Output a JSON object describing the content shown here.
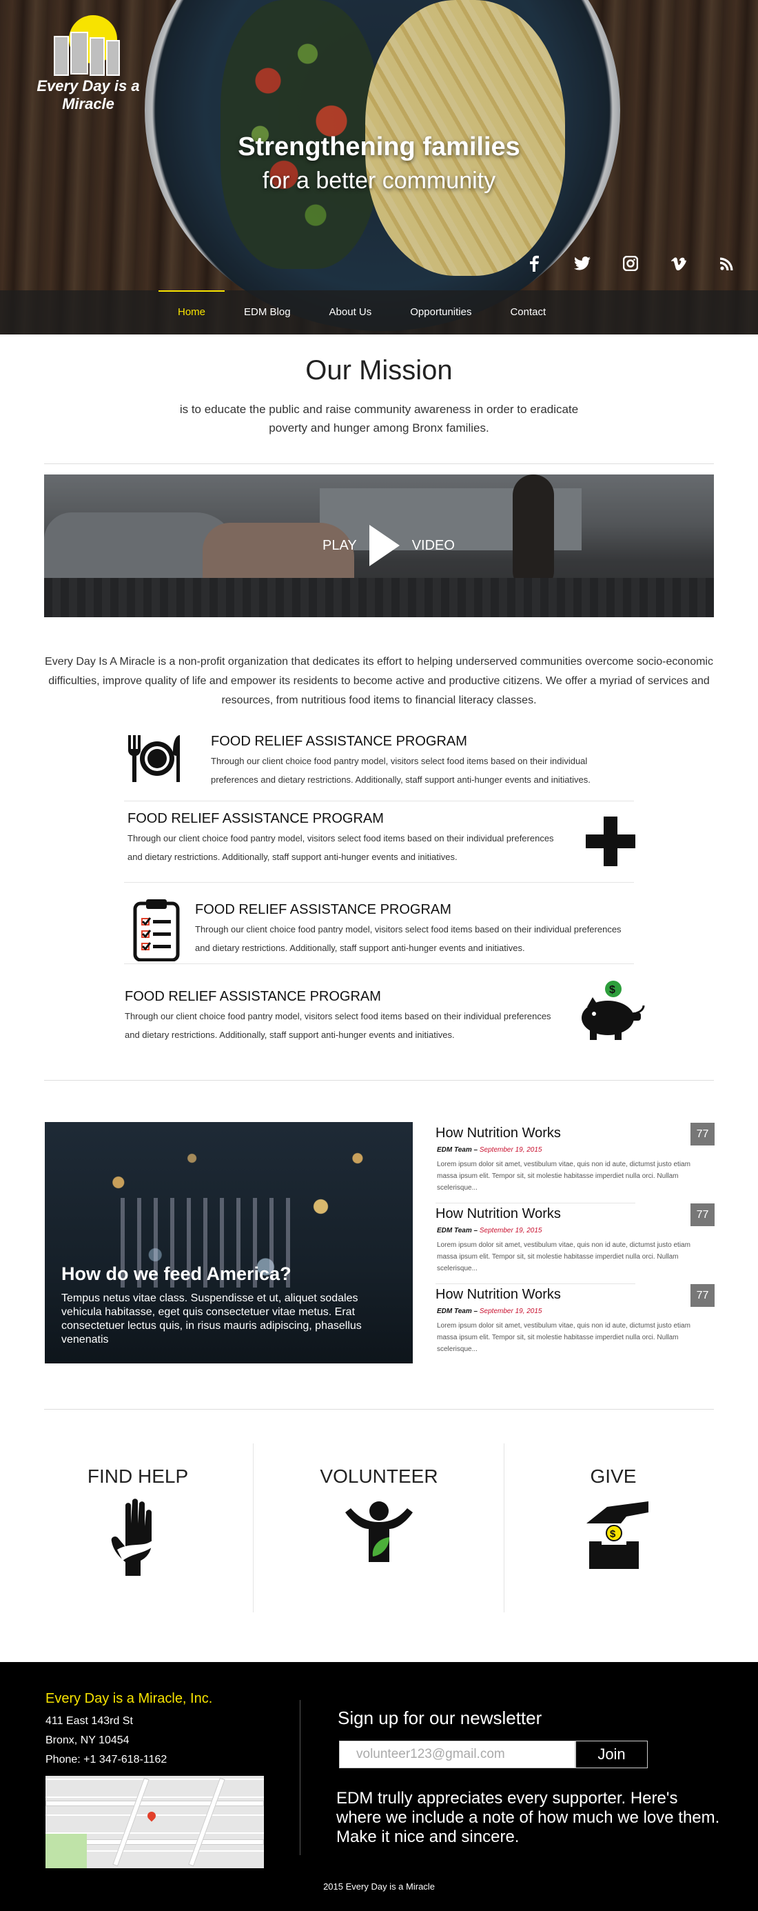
{
  "site": {
    "logo_text": "Every Day is a Miracle",
    "accent": "#f7e300"
  },
  "hero": {
    "headline": "Strengthening families",
    "subheadline": "for a better community"
  },
  "social": {
    "facebook": "f",
    "twitter": "t",
    "instagram": "ig",
    "vimeo": "v",
    "rss": "rss"
  },
  "nav": {
    "items": [
      {
        "label": "Home",
        "active": true
      },
      {
        "label": "EDM Blog",
        "active": false
      },
      {
        "label": "About Us",
        "active": false
      },
      {
        "label": "Opportunities",
        "active": false
      },
      {
        "label": "Contact",
        "active": false
      }
    ]
  },
  "mission": {
    "title": "Our Mission",
    "text": "is to educate the public and raise community awareness in order to eradicate poverty and hunger among Bronx families."
  },
  "video": {
    "play_label": "PLAY",
    "video_label": "VIDEO"
  },
  "intro": {
    "text": "Every Day Is A Miracle is a non-profit organization that dedicates its effort to helping underserved communities overcome socio-economic difficulties, improve quality of life and empower its residents to become active and productive citizens. We offer a myriad of services and resources, from nutritious food items to financial literacy classes."
  },
  "programs": [
    {
      "title": "FOOD RELIEF ASSISTANCE PROGRAM",
      "description": "Through our client choice food pantry model, visitors select food items based on their individual preferences and dietary restrictions. Additionally, staff support anti-hunger events and initiatives.",
      "icon": "utensils-plate-icon"
    },
    {
      "title": "FOOD RELIEF ASSISTANCE PROGRAM",
      "description": "Through our client choice food pantry model, visitors select food items based on their individual preferences and dietary restrictions. Additionally, staff support anti-hunger events and initiatives.",
      "icon": "plus-icon"
    },
    {
      "title": "FOOD RELIEF ASSISTANCE PROGRAM",
      "description": "Through our client choice food pantry model, visitors select food items based on their individual preferences and dietary restrictions. Additionally, staff support anti-hunger events and initiatives.",
      "icon": "clipboard-checklist-icon"
    },
    {
      "title": "FOOD RELIEF ASSISTANCE PROGRAM",
      "description": "Through our client choice food pantry model, visitors select food items based on their individual preferences and dietary restrictions. Additionally, staff support anti-hunger events and initiatives.",
      "icon": "piggy-bank-icon"
    }
  ],
  "featured": {
    "title": "How do we feed America?",
    "text": "Tempus netus vitae class. Suspendisse et ut, aliquet sodales vehicula habitasse, eget quis consectetuer vitae metus. Erat consectetuer lectus quis, in risus mauris adipiscing, phasellus venenatis"
  },
  "posts": [
    {
      "title": "How Nutrition Works",
      "author": "EDM Team –",
      "date": "September 19, 2015",
      "count": "77",
      "excerpt": "Lorem ipsum dolor sit amet, vestibulum vitae, quis non id aute, dictumst justo etiam massa ipsum elit. Tempor sit, sit molestie habitasse imperdiet nulla orci. Nullam scelerisque..."
    },
    {
      "title": "How Nutrition Works",
      "author": "EDM Team –",
      "date": "September 19, 2015",
      "count": "77",
      "excerpt": "Lorem ipsum dolor sit amet, vestibulum vitae, quis non id aute, dictumst justo etiam massa ipsum elit. Tempor sit, sit molestie habitasse imperdiet nulla orci. Nullam scelerisque..."
    },
    {
      "title": "How Nutrition Works",
      "author": "EDM Team –",
      "date": "September 19, 2015",
      "count": "77",
      "excerpt": "Lorem ipsum dolor sit amet, vestibulum vitae, quis non id aute, dictumst justo etiam massa ipsum elit. Tempor sit, sit molestie habitasse imperdiet nulla orci. Nullam scelerisque..."
    }
  ],
  "cta": [
    {
      "label": "FIND HELP",
      "icon": "helping-hand-icon"
    },
    {
      "label": "VOLUNTEER",
      "icon": "volunteer-person-icon"
    },
    {
      "label": "GIVE",
      "icon": "donation-box-icon"
    }
  ],
  "footer": {
    "org_name": "Every Day is a Miracle, Inc.",
    "address_line1": "411 East 143rd St",
    "address_line2": "Bronx, NY 10454",
    "phone": "Phone: +1 347-618-1162",
    "newsletter_title": "Sign up for our newsletter",
    "email_value": "volunteer123@gmail.com",
    "join_label": "Join",
    "note": "EDM trully appreciates every supporter. Here's where we include a note of how much we love them. Make it nice and sincere.",
    "copyright": "2015 Every Day is a Miracle"
  }
}
